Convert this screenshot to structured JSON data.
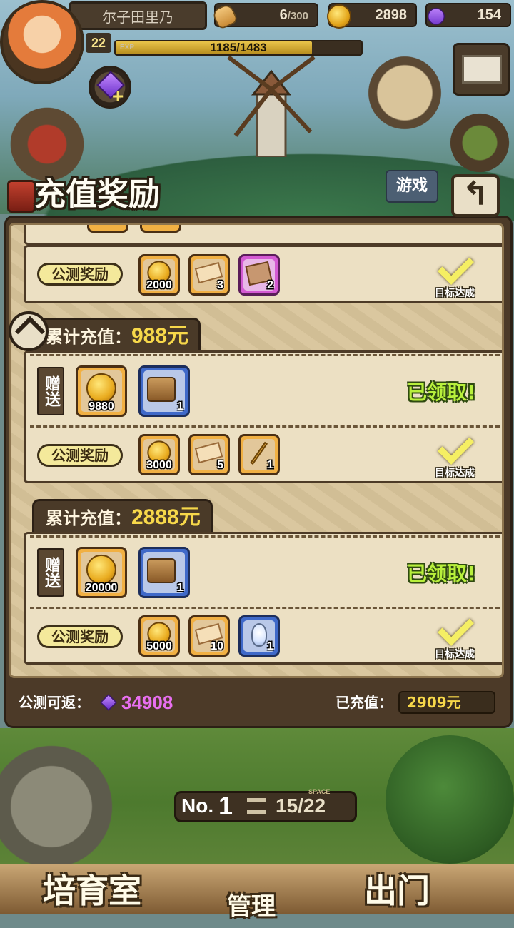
{
  "header": {
    "player_name": "尔子田里乃",
    "level": "22",
    "exp_label": "EXP",
    "exp_text": "1185/1483",
    "exp_ratio": 0.799,
    "bread_current": "6",
    "bread_max": "/300",
    "gold": "2898",
    "gems": "154"
  },
  "buttons": {
    "game": "游戏"
  },
  "panel": {
    "title": "充值奖励",
    "back_glyph": "↰",
    "achieved_label": "目标达成",
    "claimed_label": "已领取!",
    "gift_label": "赠送",
    "beta_label": "公测奖励",
    "tier_label": "累计充值：",
    "tiers": [
      {
        "amount": "",
        "gift_items": [],
        "beta_items": [
          {
            "kind": "coin",
            "qty": "2000",
            "frame": "gold"
          },
          {
            "kind": "ticket",
            "qty": "3",
            "frame": "gold"
          },
          {
            "kind": "ticket-purple",
            "qty": "2",
            "frame": "pink"
          }
        ]
      },
      {
        "amount": "988元",
        "gift_items": [
          {
            "kind": "coin",
            "qty": "9880",
            "frame": "gold"
          },
          {
            "kind": "chest",
            "qty": "1",
            "frame": "blue"
          }
        ],
        "beta_items": [
          {
            "kind": "coin",
            "qty": "3000",
            "frame": "gold"
          },
          {
            "kind": "ticket",
            "qty": "5",
            "frame": "gold"
          },
          {
            "kind": "key",
            "qty": "1",
            "frame": "gold"
          }
        ]
      },
      {
        "amount": "2888元",
        "gift_items": [
          {
            "kind": "coin",
            "qty": "20000",
            "frame": "gold"
          },
          {
            "kind": "chest",
            "qty": "1",
            "frame": "blue"
          }
        ],
        "beta_items": [
          {
            "kind": "coin",
            "qty": "5000",
            "frame": "gold"
          },
          {
            "kind": "ticket",
            "qty": "10",
            "frame": "gold"
          },
          {
            "kind": "egg",
            "qty": "1",
            "frame": "blue"
          }
        ]
      }
    ]
  },
  "footer": {
    "refund_label": "公测可返：",
    "refund_value": "34908",
    "charged_label": "已充值：",
    "charged_value": "2909元"
  },
  "bottom": {
    "no_label": "No.",
    "no_value": "1",
    "space_tag": "SPACE",
    "space_value": "15/22",
    "nav_left": "培育室",
    "nav_center": "管理",
    "nav_right": "出门"
  },
  "colors": {
    "accent_gold": "#f7d84a",
    "claimed_green": "#b8f03c",
    "gem_purple": "#e86ff0"
  }
}
